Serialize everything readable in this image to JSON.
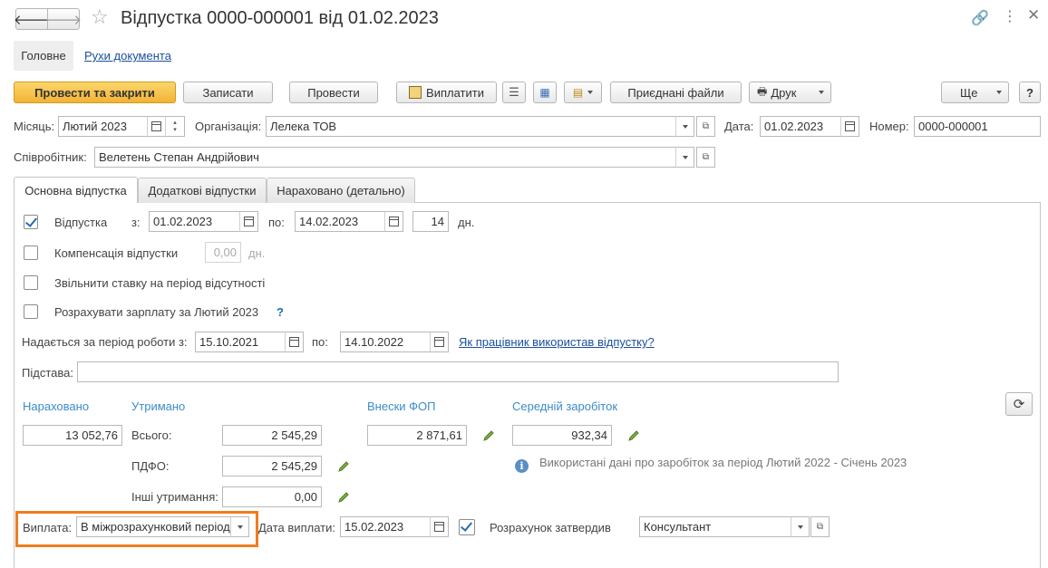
{
  "window": {
    "title": "Відпустка 0000-000001 від 01.02.2023"
  },
  "nav": {
    "main": "Головне",
    "movements": "Рухи документа"
  },
  "toolbar": {
    "post_close": "Провести та закрити",
    "save": "Записати",
    "post": "Провести",
    "pay": "Виплатити",
    "files": "Приєднані файли",
    "print": "Друк",
    "more": "Ще",
    "help": "?"
  },
  "header": {
    "month_label": "Місяць:",
    "month_value": "Лютий 2023",
    "org_label": "Організація:",
    "org_value": "Лелека ТОВ",
    "date_label": "Дата:",
    "date_value": "01.02.2023",
    "number_label": "Номер:",
    "number_value": "0000-000001",
    "employee_label": "Співробітник:",
    "employee_value": "Велетень Степан Андрійович"
  },
  "tabs": [
    "Основна відпустка",
    "Додаткові відпустки",
    "Нараховано (детально)"
  ],
  "vacation": {
    "label": "Відпустка",
    "checked": true,
    "from_label": "з:",
    "from_value": "01.02.2023",
    "to_label": "по:",
    "to_value": "14.02.2023",
    "days_value": "14",
    "days_unit": "дн."
  },
  "compensation": {
    "label": "Компенсація відпустки",
    "value": "0,00",
    "unit": "дн.",
    "checked": false
  },
  "release_rate": {
    "label": "Звільнити ставку на період відсутності",
    "checked": false
  },
  "calc_salary": {
    "label": "Розрахувати зарплату за Лютий 2023",
    "help": "?",
    "checked": false
  },
  "period": {
    "label": "Надається за період роботи з:",
    "from_value": "15.10.2021",
    "to_label": "по:",
    "to_value": "14.10.2022",
    "link": "Як працівник використав відпустку?"
  },
  "basis": {
    "label": "Підстава:",
    "value": ""
  },
  "totals": {
    "accrued_header": "Нараховано",
    "accrued_value": "13 052,76",
    "withheld_header": "Утримано",
    "total_label": "Всього:",
    "total_value": "2 545,29",
    "pdfo_label": "ПДФО:",
    "pdfo_value": "2 545,29",
    "other_label": "Інші утримання:",
    "other_value": "0,00",
    "fop_header": "Внески ФОП",
    "fop_value": "2 871,61",
    "avg_header": "Середній заробіток",
    "avg_value": "932,34",
    "info_text": "Використані дані про заробіток за період Лютий 2022 - Січень 2023"
  },
  "payment": {
    "label": "Виплата:",
    "value": "В міжрозрахунковий період",
    "date_label": "Дата виплати:",
    "date_value": "15.02.2023",
    "approved_checked": true,
    "approved_label": "Розрахунок затвердив",
    "approver_value": "Консультант"
  },
  "colors": {
    "accent": "#f2b335",
    "highlight": "#f07d1e",
    "link": "#1a4f9c",
    "header_blue": "#3c8cc8"
  }
}
